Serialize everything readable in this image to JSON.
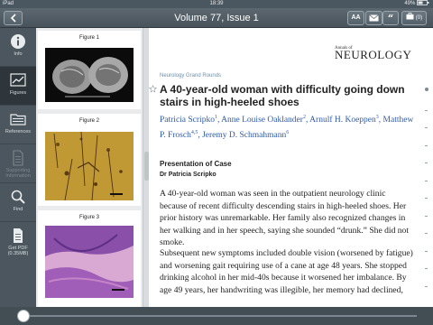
{
  "statusbar": {
    "device": "iPad",
    "time": "18:39",
    "battery": "49%"
  },
  "titlebar": {
    "back_icon": "chevron-left-icon",
    "title": "Volume 77, Issue 1",
    "font_size_label": "AA",
    "saved_label": "(0)"
  },
  "leftnav": {
    "items": [
      {
        "label": "Info",
        "icon": "info-icon",
        "state": "normal"
      },
      {
        "label": "Figures",
        "icon": "chart-icon",
        "state": "active"
      },
      {
        "label": "References",
        "icon": "folder-icon",
        "state": "normal"
      },
      {
        "label": "Supporting Information",
        "icon": "document-icon",
        "state": "disabled"
      },
      {
        "label": "Find",
        "icon": "search-icon",
        "state": "normal"
      },
      {
        "label": "Get PDF (0.35MB)",
        "icon": "pdf-icon",
        "state": "normal"
      }
    ]
  },
  "figures": [
    {
      "caption": "Figure 1"
    },
    {
      "caption": "Figure 2"
    },
    {
      "caption": "Figure 3"
    }
  ],
  "article": {
    "journal_small": "Annals of",
    "journal_big": "NEUROLOGY",
    "section": "Neurology Grand Rounds",
    "headline": "A 40-year-old woman with difficulty going down stairs in high-heeled shoes",
    "authors_line1_a": "Patricia Scripko",
    "authors_line1_a_sup": "1",
    "authors_line1_b": ", Anne Louise Oaklander",
    "authors_line1_b_sup": "2",
    "authors_line1_c": ", Arnulf H. Koeppen",
    "authors_line1_c_sup": "3",
    "authors_line1_d": ", Matthew",
    "authors_line2_a": "P. Frosch",
    "authors_line2_a_sup": "4,5",
    "authors_line2_b": ", Jeremy D. Schmahmann",
    "authors_line2_b_sup": "6",
    "presentation_heading": "Presentation of Case",
    "byline": "Dr Patricia Scripko",
    "paragraph1": "A 40-year-old woman was seen in the outpatient neurology clinic because of recent difficulty descending stairs in high-heeled shoes. Her prior history was unremarkable. Her family also recognized changes in her walking and in her speech, saying she sounded “drunk.” She did not smoke.",
    "paragraph2": "Subsequent new symptoms included double vision (worsened by fatigue) and worsening gait requiring use of a cane at age 48 years. She stopped drinking alcohol in her mid-40s because it worsened her imbalance. By age 49 years, her handwriting was illegible, her memory had declined,"
  },
  "progress": {
    "value": 0.0
  }
}
